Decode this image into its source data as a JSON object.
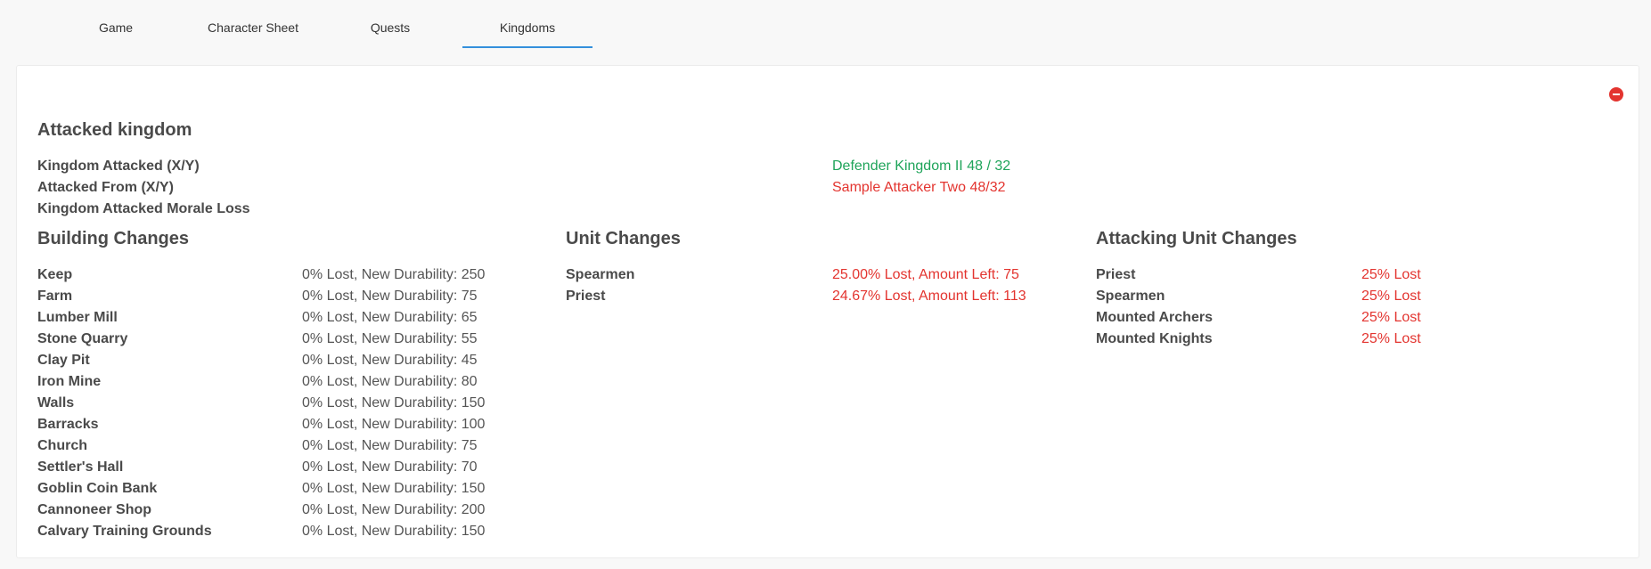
{
  "tabs": [
    {
      "label": "Game"
    },
    {
      "label": "Character Sheet"
    },
    {
      "label": "Quests"
    },
    {
      "label": "Kingdoms"
    }
  ],
  "report": {
    "title": "Attacked kingdom",
    "kingdom_attacked_label": "Kingdom Attacked (X/Y)",
    "kingdom_attacked_value": "Defender Kingdom II 48 / 32",
    "attacked_from_label": "Attacked From (X/Y)",
    "attacked_from_value": "Sample Attacker Two 48/32",
    "morale_loss_label": "Kingdom Attacked Morale Loss",
    "morale_loss_value": ""
  },
  "building_changes": {
    "title": "Building Changes",
    "rows": [
      {
        "name": "Keep",
        "value": "0% Lost, New Durability: 250"
      },
      {
        "name": "Farm",
        "value": "0% Lost, New Durability: 75"
      },
      {
        "name": "Lumber Mill",
        "value": "0% Lost, New Durability: 65"
      },
      {
        "name": "Stone Quarry",
        "value": "0% Lost, New Durability: 55"
      },
      {
        "name": "Clay Pit",
        "value": "0% Lost, New Durability: 45"
      },
      {
        "name": "Iron Mine",
        "value": "0% Lost, New Durability: 80"
      },
      {
        "name": "Walls",
        "value": "0% Lost, New Durability: 150"
      },
      {
        "name": "Barracks",
        "value": "0% Lost, New Durability: 100"
      },
      {
        "name": "Church",
        "value": "0% Lost, New Durability: 75"
      },
      {
        "name": "Settler's Hall",
        "value": "0% Lost, New Durability: 70"
      },
      {
        "name": "Goblin Coin Bank",
        "value": "0% Lost, New Durability: 150"
      },
      {
        "name": "Cannoneer Shop",
        "value": "0% Lost, New Durability: 200"
      },
      {
        "name": "Calvary Training Grounds",
        "value": "0% Lost, New Durability: 150"
      }
    ]
  },
  "unit_changes": {
    "title": "Unit Changes",
    "rows": [
      {
        "name": "Spearmen",
        "value": "25.00% Lost, Amount Left: 75"
      },
      {
        "name": "Priest",
        "value": "24.67% Lost, Amount Left: 113"
      }
    ]
  },
  "attacking_unit_changes": {
    "title": "Attacking Unit Changes",
    "rows": [
      {
        "name": "Priest",
        "value": "25% Lost"
      },
      {
        "name": "Spearmen",
        "value": "25% Lost"
      },
      {
        "name": "Mounted Archers",
        "value": "25% Lost"
      },
      {
        "name": "Mounted Knights",
        "value": "25% Lost"
      }
    ]
  },
  "colors": {
    "accent": "#3490dc",
    "success": "#1fa45a",
    "danger": "#e3342f"
  },
  "icons": {
    "close": "minus-circle-icon"
  }
}
